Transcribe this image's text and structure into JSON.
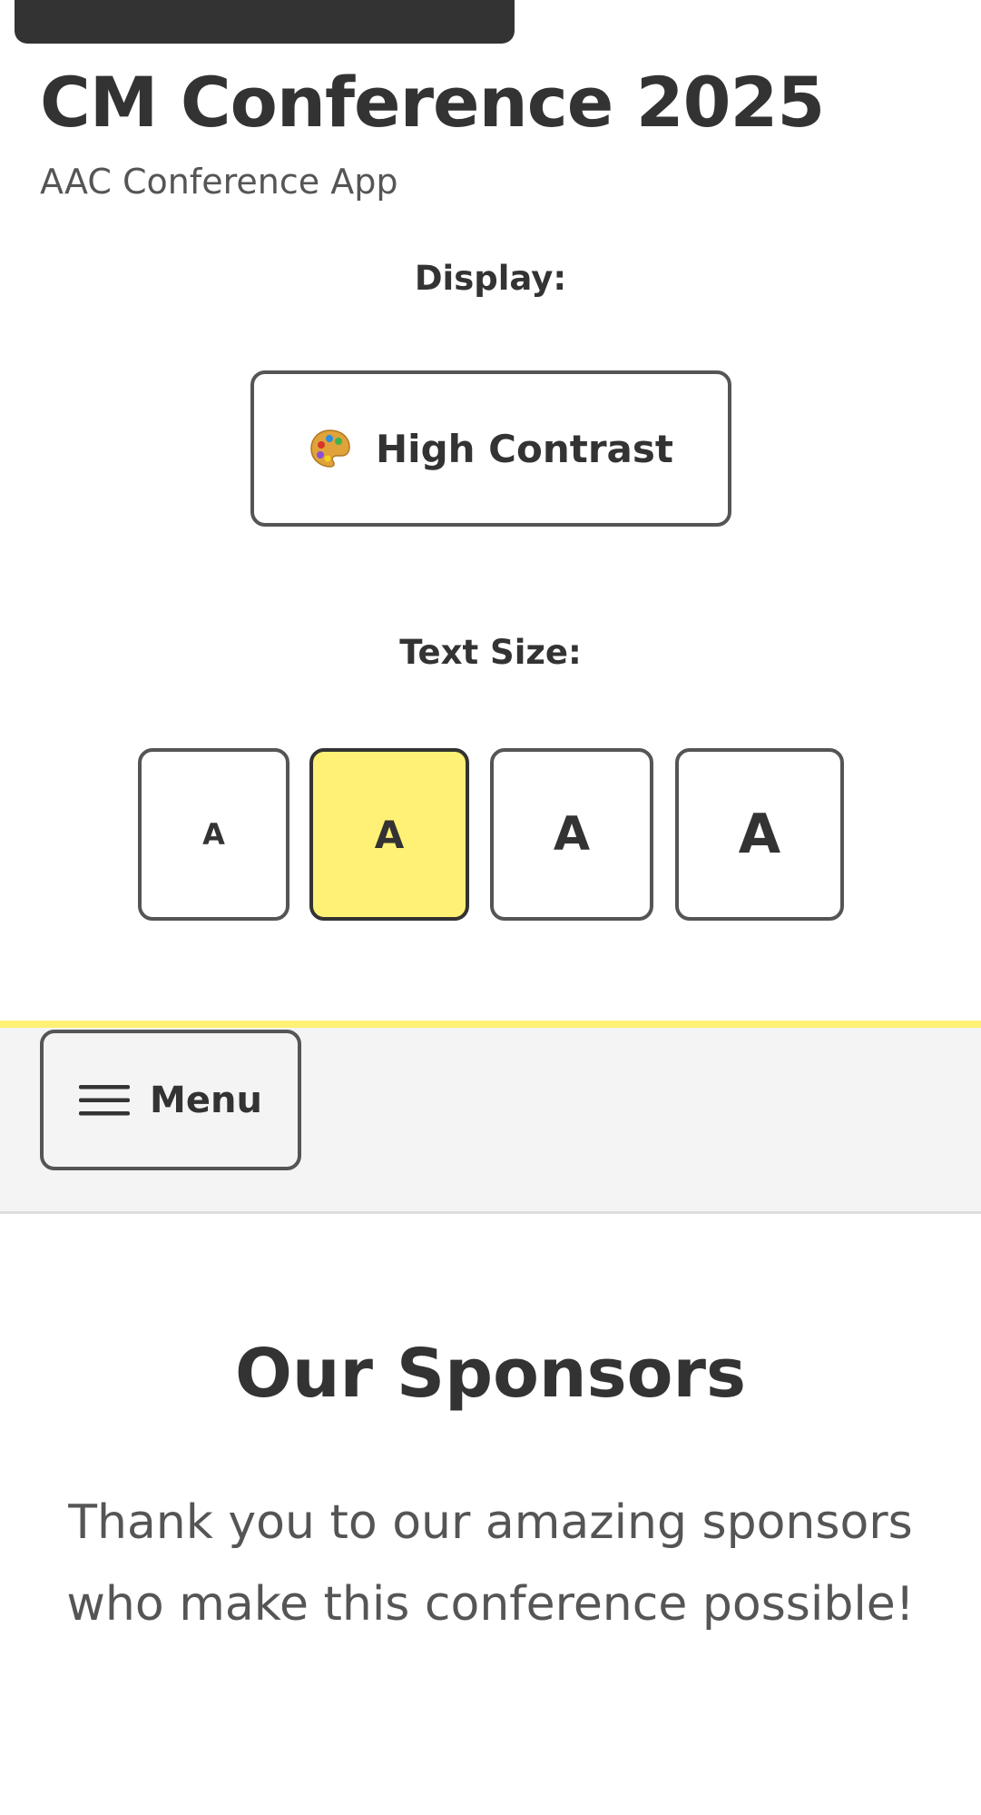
{
  "header": {
    "title": "CM Conference 2025",
    "subtitle": "AAC Conference App"
  },
  "display": {
    "label": "Display:",
    "contrast_button": {
      "label": "High Contrast",
      "icon": "palette-icon"
    }
  },
  "text_size": {
    "label": "Text Size:",
    "options": [
      {
        "label": "A",
        "size": "small",
        "selected": false
      },
      {
        "label": "A",
        "size": "medium",
        "selected": true
      },
      {
        "label": "A",
        "size": "large",
        "selected": false
      },
      {
        "label": "A",
        "size": "extra-large",
        "selected": false
      }
    ]
  },
  "nav": {
    "menu_label": "Menu",
    "menu_icon": "hamburger-icon"
  },
  "main": {
    "sponsors_title": "Our Sponsors",
    "sponsors_text": "Thank you to our amazing sponsors who make this conference possible!"
  },
  "colors": {
    "accent": "#fff176",
    "text": "#333333",
    "muted_text": "#555555",
    "top_bar": "#333333",
    "nav_background": "#f4f4f4"
  }
}
